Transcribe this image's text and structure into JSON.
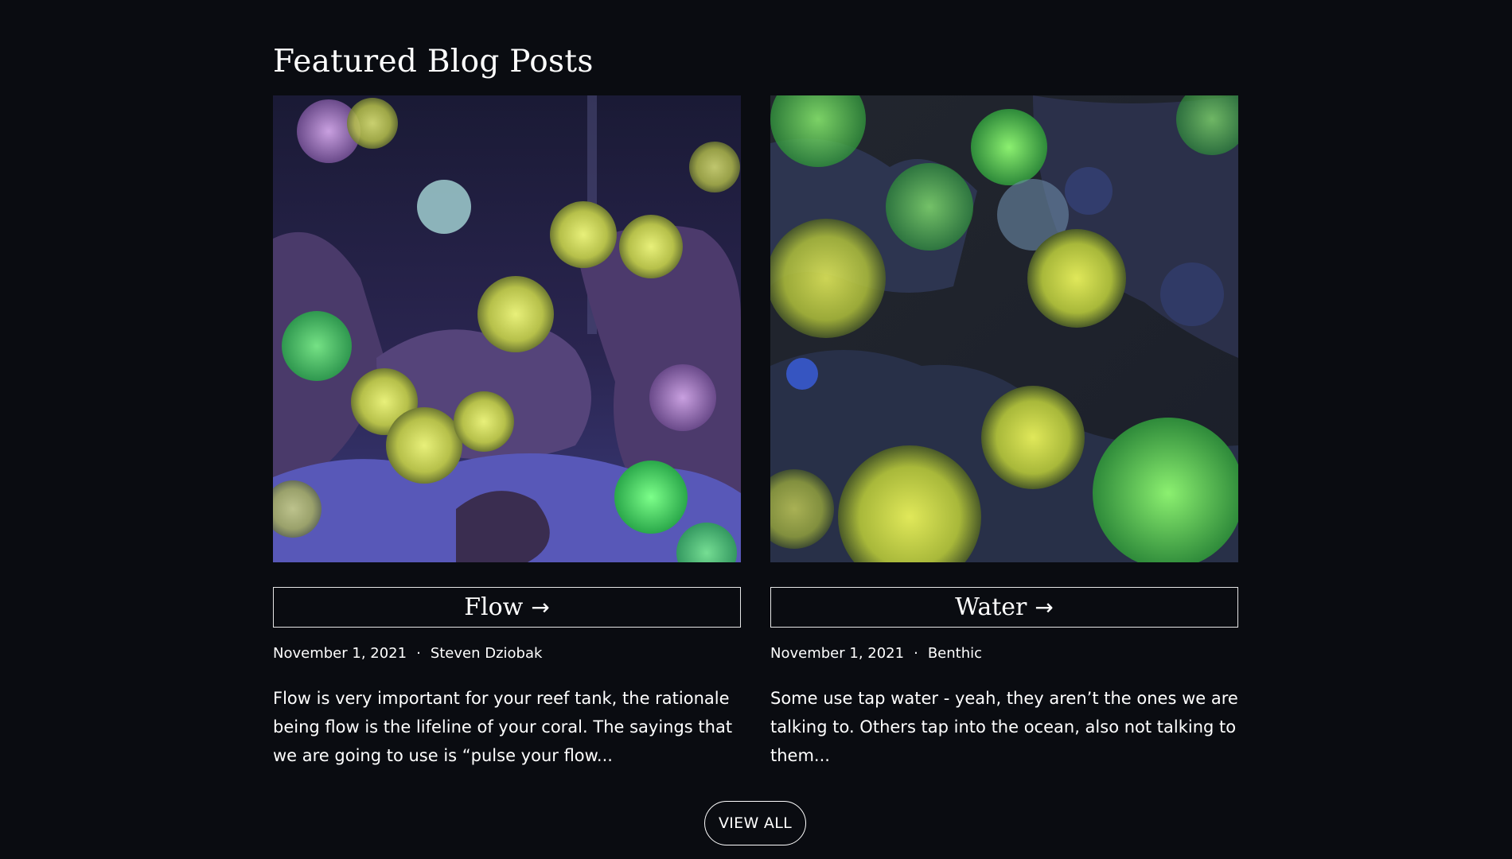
{
  "section": {
    "title": "Featured Blog Posts"
  },
  "posts": [
    {
      "title": "Flow",
      "arrow": "→",
      "date": "November 1, 2021",
      "separator": "·",
      "author": "Steven Dziobak",
      "excerpt": "Flow is very important for your reef tank, the rationale being flow is the lifeline of your coral. The sayings that we are going to use is “pulse your flow..."
    },
    {
      "title": "Water",
      "arrow": "→",
      "date": "November 1, 2021",
      "separator": "·",
      "author": "Benthic",
      "excerpt": "Some use tap water - yeah, they aren’t the ones we are talking to. Others tap into the ocean, also not talking to them..."
    }
  ],
  "view_all_label": "VIEW ALL",
  "colors": {
    "background": "#0a0c11",
    "text": "#ffffff",
    "border": "#e6e6e6"
  }
}
